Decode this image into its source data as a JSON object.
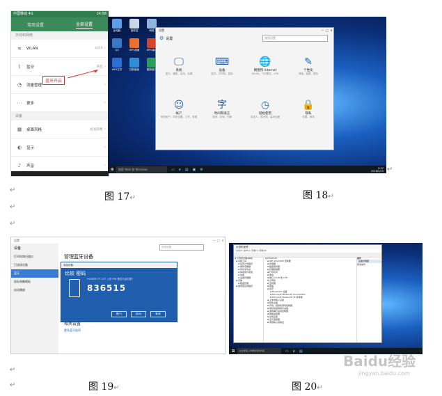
{
  "captions": {
    "fig17": "图 17",
    "fig18": "图 18",
    "fig19": "图 19",
    "fig20": "图 20"
  },
  "para_mark": "↵",
  "fig17_phone": {
    "status_left": "中国移动 4G",
    "status_right": "14:58",
    "tabs": [
      "常用设置",
      "全部设置"
    ],
    "section_network": "无线和网络",
    "rows_network": [
      {
        "icon": "wifi-icon",
        "glyph": "≋",
        "label": "WLAN",
        "value": "a310"
      },
      {
        "icon": "bluetooth-icon",
        "glyph": "ᛒ",
        "label": "蓝牙",
        "value": "开启"
      },
      {
        "icon": "data-usage-icon",
        "glyph": "◔",
        "label": "流量管理",
        "value": ""
      },
      {
        "icon": "more-icon",
        "glyph": "⋯",
        "label": "更多",
        "value": ""
      }
    ],
    "section_device": "设备",
    "rows_device": [
      {
        "icon": "desktop-style-icon",
        "glyph": "▦",
        "label": "桌面风格",
        "value": "标准风格"
      },
      {
        "icon": "display-icon",
        "glyph": "◐",
        "label": "显示",
        "value": ""
      },
      {
        "icon": "sound-icon",
        "glyph": "♪",
        "label": "声音",
        "value": ""
      }
    ],
    "callout": "蓝牙开启"
  },
  "fig18_desktop": {
    "window_title": "设置",
    "header": "设置",
    "search_placeholder": "查找设置",
    "categories": [
      {
        "icon": "system-icon",
        "glyph": "🖵",
        "name": "系统",
        "desc": "显示、通知、应用、电源"
      },
      {
        "icon": "devices-icon",
        "glyph": "⌨",
        "name": "设备",
        "desc": "蓝牙、打印机、鼠标"
      },
      {
        "icon": "network-icon",
        "glyph": "🌐",
        "name": "网络和 Internet",
        "desc": "WLAN、飞行模式、VPN"
      },
      {
        "icon": "personalization-icon",
        "glyph": "✎",
        "name": "个性化",
        "desc": "背景、锁屏、颜色"
      },
      {
        "icon": "accounts-icon",
        "glyph": "☺",
        "name": "帐户",
        "desc": "你的帐户、同步设置、工作、家庭"
      },
      {
        "icon": "time-language-icon",
        "glyph": "字",
        "name": "时间和语言",
        "desc": "语音、区域、日期"
      },
      {
        "icon": "ease-of-access-icon",
        "glyph": "◷",
        "name": "轻松使用",
        "desc": "讲述人、放大镜、高对比度"
      },
      {
        "icon": "privacy-icon",
        "glyph": "🔒",
        "name": "隐私",
        "desc": "位置、相机"
      }
    ],
    "desktop_icons": [
      "此电脑",
      "QQ",
      "WPS文字",
      "回收站",
      "WPS表格",
      "控制面板",
      "网络",
      "WPS演示",
      "酷狗音乐"
    ],
    "taskbar_search": "搜索 Web 和 Windows",
    "clock_time": "9:37",
    "clock_date": "2016/5/15"
  },
  "fig19_settings": {
    "window_title": "设置",
    "sidebar_header": "设备",
    "sidebar_items": [
      "打印机和扫描仪",
      "已连接设备",
      "蓝牙",
      "鼠标和触摸板",
      "自动播放"
    ],
    "selected_index": 2,
    "main_title": "管理蓝牙设备",
    "search_placeholder": "查找设置",
    "related_title": "相关设置",
    "related_link": "更多蓝牙选项",
    "dialog": {
      "title": "添加设备",
      "heading": "比较 密码",
      "subtitle": "HUAWEI P7-L07 上的 PIN 是否与此匹配?",
      "passcode": "836515",
      "buttons": [
        "是(Y)",
        "否(N)",
        "取消"
      ]
    }
  },
  "fig20_devmgr": {
    "window_title": "计算机管理",
    "menu": "文件(F)  操作(A)  查看(V)  帮助(H)",
    "left_tree": [
      "计算机管理(本地)",
      "系统工具",
      "任务计划程序",
      "事件查看器",
      "共享文件夹",
      "本地用户和组",
      "性能",
      "设备管理器",
      "存储",
      "磁盘管理",
      "服务和应用程序"
    ],
    "device_tree": [
      "DESKTOP",
      "IDE ATA/ATAPI 控制器",
      "处理器",
      "磁盘驱动器",
      "存储控制器",
      "打印队列",
      "电池",
      "端口 (COM 和 LPT)",
      "计算机",
      "监视器",
      "键盘",
      "蓝牙",
      "Bluetooth 设备",
      "Microsoft Bluetooth Enumerator",
      "Microsoft Bluetooth LE 枚举器",
      "人体学输入设备",
      "软件设备",
      "声音、视频和游戏控制器",
      "鼠标和其他指针设备",
      "通用串行总线控制器",
      "网络适配器",
      "系统设备",
      "显示适配器",
      "音频输入和输出"
    ],
    "actions_title": "操作",
    "actions_sub": "设备管理器",
    "actions_more": "更多操作",
    "taskbar_search": "在这里输入你要搜索的内容"
  },
  "watermark": {
    "logo": "Baidu经验",
    "url": "jingyan.baidu.com"
  }
}
